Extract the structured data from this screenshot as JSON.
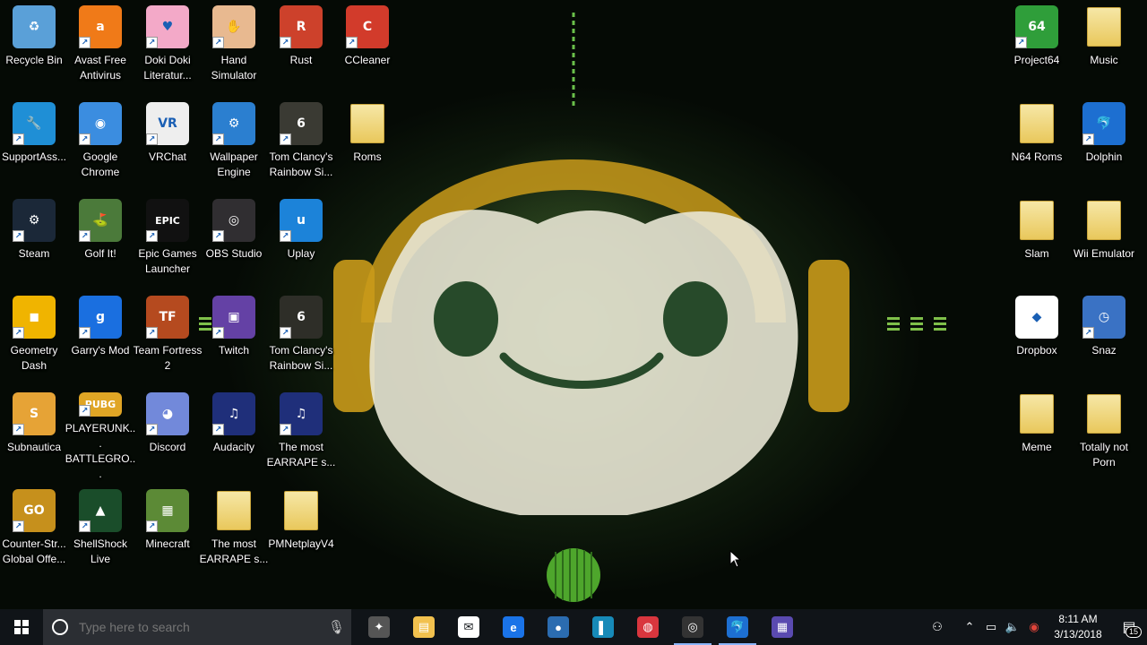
{
  "desktop": {
    "icons": [
      {
        "id": "recycle-bin",
        "label": "Recycle Bin",
        "color": "#5aa0d8",
        "glyph": "♻",
        "shortcut": false
      },
      {
        "id": "avast",
        "label": "Avast Free Antivirus",
        "color": "#f07a18",
        "glyph": "a",
        "shortcut": true
      },
      {
        "id": "doki-doki",
        "label": "Doki Doki Literatur...",
        "color": "#f3a9c8",
        "glyph": "♥",
        "shortcut": true
      },
      {
        "id": "hand-simulator",
        "label": "Hand Simulator",
        "color": "#e8b990",
        "glyph": "✋",
        "shortcut": true
      },
      {
        "id": "rust",
        "label": "Rust",
        "color": "#cd412b",
        "glyph": "R",
        "shortcut": true
      },
      {
        "id": "ccleaner",
        "label": "CCleaner",
        "color": "#d23b2b",
        "glyph": "C",
        "shortcut": true
      },
      {
        "id": "supportassist",
        "label": "SupportAss...",
        "color": "#1f8fd6",
        "glyph": "🔧",
        "shortcut": true
      },
      {
        "id": "google-chrome",
        "label": "Google Chrome",
        "color": "#3b8de0",
        "glyph": "◉",
        "shortcut": true
      },
      {
        "id": "vrchat",
        "label": "VRChat",
        "color": "#eeeeee",
        "glyph": "VR",
        "shortcut": true
      },
      {
        "id": "wallpaper-engine",
        "label": "Wallpaper Engine",
        "color": "#2b7fd0",
        "glyph": "⚙",
        "shortcut": true
      },
      {
        "id": "rainbow-six",
        "label": "Tom Clancy's Rainbow Si...",
        "color": "#3a3a33",
        "glyph": "6",
        "shortcut": true
      },
      {
        "id": "roms",
        "label": "Roms",
        "color": "",
        "glyph": "",
        "shortcut": false,
        "folder": true
      },
      {
        "id": "steam",
        "label": "Steam",
        "color": "#1b2838",
        "glyph": "⚙",
        "shortcut": true
      },
      {
        "id": "golf-it",
        "label": "Golf It!",
        "color": "#4b7a3a",
        "glyph": "⛳",
        "shortcut": true
      },
      {
        "id": "epic-games",
        "label": "Epic Games Launcher",
        "color": "#111111",
        "glyph": "EPIC",
        "shortcut": true
      },
      {
        "id": "obs-studio",
        "label": "OBS Studio",
        "color": "#302e31",
        "glyph": "◎",
        "shortcut": true
      },
      {
        "id": "uplay",
        "label": "Uplay",
        "color": "#1c83d9",
        "glyph": "u",
        "shortcut": true
      },
      {
        "id": "geometry-dash",
        "label": "Geometry Dash",
        "color": "#f0b400",
        "glyph": "◼",
        "shortcut": true
      },
      {
        "id": "garrys-mod",
        "label": "Garry's Mod",
        "color": "#1a6fe0",
        "glyph": "g",
        "shortcut": true
      },
      {
        "id": "tf2",
        "label": "Team Fortress 2",
        "color": "#b54a1f",
        "glyph": "TF",
        "shortcut": true
      },
      {
        "id": "twitch",
        "label": "Twitch",
        "color": "#6441a5",
        "glyph": "▣",
        "shortcut": true
      },
      {
        "id": "rainbow-six-ts",
        "label": "Tom Clancy's Rainbow Si...",
        "color": "#2e2e28",
        "glyph": "6",
        "shortcut": true
      },
      {
        "id": "subnautica",
        "label": "Subnautica",
        "color": "#e6a336",
        "glyph": "S",
        "shortcut": true
      },
      {
        "id": "pubg",
        "label": "PLAYERUNK... BATTLEGRO...",
        "color": "#e0a525",
        "glyph": "PUBG",
        "shortcut": true
      },
      {
        "id": "discord",
        "label": "Discord",
        "color": "#7289da",
        "glyph": "◕",
        "shortcut": true
      },
      {
        "id": "audacity",
        "label": "Audacity",
        "color": "#1f2f7a",
        "glyph": "♫",
        "shortcut": true
      },
      {
        "id": "earrape-1",
        "label": "The most EARRAPE s...",
        "color": "#1f2f7a",
        "glyph": "♫",
        "shortcut": true
      },
      {
        "id": "csgo",
        "label": "Counter-Str... Global Offe...",
        "color": "#c6901c",
        "glyph": "GO",
        "shortcut": true
      },
      {
        "id": "shellshock",
        "label": "ShellShock Live",
        "color": "#1a4d2a",
        "glyph": "▲",
        "shortcut": true
      },
      {
        "id": "minecraft",
        "label": "Minecraft",
        "color": "#5c8a36",
        "glyph": "▦",
        "shortcut": true
      },
      {
        "id": "earrape-2",
        "label": "The most EARRAPE s...",
        "color": "",
        "glyph": "",
        "shortcut": false,
        "folder": true
      },
      {
        "id": "pmnetplay",
        "label": "PMNetplayV4",
        "color": "",
        "glyph": "",
        "shortcut": false,
        "folder": true
      },
      {
        "id": "project64",
        "label": "Project64",
        "color": "#2f9e3a",
        "glyph": "64",
        "shortcut": true
      },
      {
        "id": "music",
        "label": "Music",
        "color": "",
        "glyph": "",
        "shortcut": false,
        "folder": true
      },
      {
        "id": "n64-roms",
        "label": "N64 Roms",
        "color": "",
        "glyph": "",
        "shortcut": false,
        "folder": true
      },
      {
        "id": "dolphin",
        "label": "Dolphin",
        "color": "#1d6fd1",
        "glyph": "🐬",
        "shortcut": true
      },
      {
        "id": "slam",
        "label": "Slam",
        "color": "",
        "glyph": "",
        "shortcut": false,
        "folder": true
      },
      {
        "id": "wii-emulator",
        "label": "Wii Emulator",
        "color": "",
        "glyph": "",
        "shortcut": false,
        "folder": true
      },
      {
        "id": "dropbox",
        "label": "Dropbox",
        "color": "#ffffff",
        "glyph": "◆",
        "shortcut": false
      },
      {
        "id": "snaz",
        "label": "Snaz",
        "color": "#3a72c4",
        "glyph": "◷",
        "shortcut": true
      },
      {
        "id": "meme",
        "label": "Meme",
        "color": "",
        "glyph": "",
        "shortcut": false,
        "folder": true
      },
      {
        "id": "totally-not-porn",
        "label": "Totally not Porn",
        "color": "",
        "glyph": "",
        "shortcut": false,
        "folder": true
      }
    ]
  },
  "taskbar": {
    "search_placeholder": "Type here to search",
    "apps": [
      {
        "id": "cortana",
        "glyph": "✦",
        "color": "#555"
      },
      {
        "id": "file-explorer",
        "glyph": "▤",
        "color": "#f2c14e"
      },
      {
        "id": "mail",
        "glyph": "✉",
        "color": "#ffffff"
      },
      {
        "id": "edge",
        "glyph": "e",
        "color": "#1a73e8"
      },
      {
        "id": "app-blue",
        "glyph": "●",
        "color": "#2b6cb0"
      },
      {
        "id": "app-teal",
        "glyph": "▌",
        "color": "#178ab8"
      },
      {
        "id": "app-red",
        "glyph": "◍",
        "color": "#d9363e"
      },
      {
        "id": "obs",
        "glyph": "◎",
        "color": "#333333"
      },
      {
        "id": "dolphin",
        "glyph": "🐬",
        "color": "#1d6fd1"
      },
      {
        "id": "app-flag",
        "glyph": "▦",
        "color": "#5a4ab0"
      }
    ],
    "clock": {
      "time": "8:11 AM",
      "date": "3/13/2018"
    },
    "notification_count": "15"
  }
}
